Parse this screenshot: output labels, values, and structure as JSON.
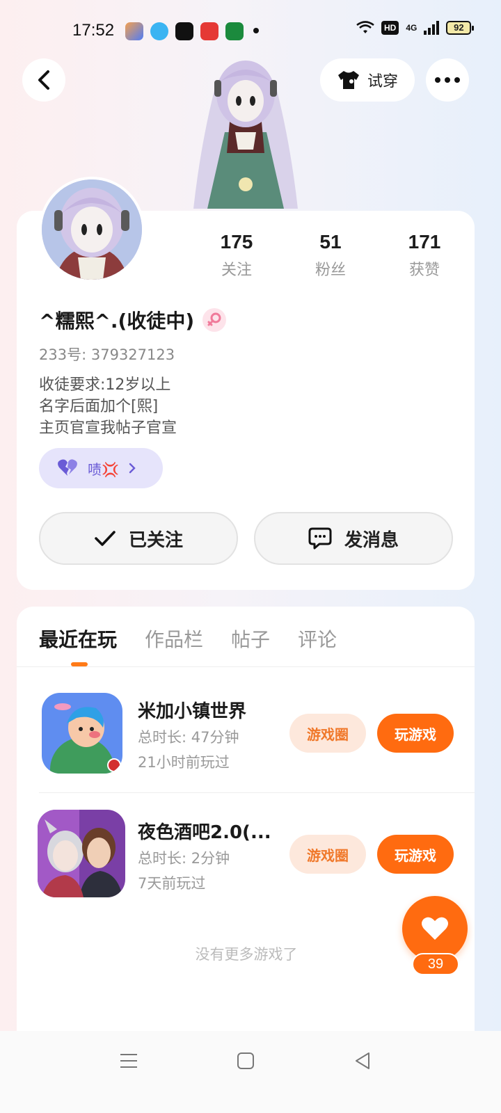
{
  "status_bar": {
    "time": "17:52",
    "network": "4G",
    "hd": "HD",
    "battery": "92",
    "app_icons": [
      "#4f7cf6",
      "#3bb4f2",
      "#111111",
      "#e53935",
      "#1b8a3d"
    ]
  },
  "header": {
    "back_icon": "chevron-left-icon",
    "try_on_label": "试穿",
    "try_on_icon": "tshirt-icon",
    "more_icon": "more-dots-icon"
  },
  "profile": {
    "username": "^糯熙^.(收徒中)",
    "gender_icon": "female-icon",
    "uid_label": "233号:",
    "uid_value": "379327123",
    "bio_lines": [
      "收徒要求:12岁以上",
      "名字后面加个[熙]",
      "主页官宣我帖子官宣"
    ],
    "badge_text": "啧💢",
    "stats": [
      {
        "value": "175",
        "label": "关注"
      },
      {
        "value": "51",
        "label": "粉丝"
      },
      {
        "value": "171",
        "label": "获赞"
      }
    ],
    "follow_button": "已关注",
    "message_button": "发消息"
  },
  "tabs": [
    {
      "label": "最近在玩",
      "active": true
    },
    {
      "label": "作品栏",
      "active": false
    },
    {
      "label": "帖子",
      "active": false
    },
    {
      "label": "评论",
      "active": false
    }
  ],
  "games": [
    {
      "name": "米加小镇世界",
      "duration": "总时长: 47分钟",
      "last_played": "21小时前玩过",
      "circle_button": "游戏圈",
      "play_button": "玩游戏"
    },
    {
      "name": "夜色酒吧2.0(...",
      "duration": "总时长: 2分钟",
      "last_played": "7天前玩过",
      "circle_button": "游戏圈",
      "play_button": "玩游戏"
    }
  ],
  "no_more_text": "没有更多游戏了",
  "like_count": "39",
  "colors": {
    "accent": "#ff6b10",
    "accent_light": "#fde8dc",
    "badge_bg": "#e6e4fb"
  }
}
